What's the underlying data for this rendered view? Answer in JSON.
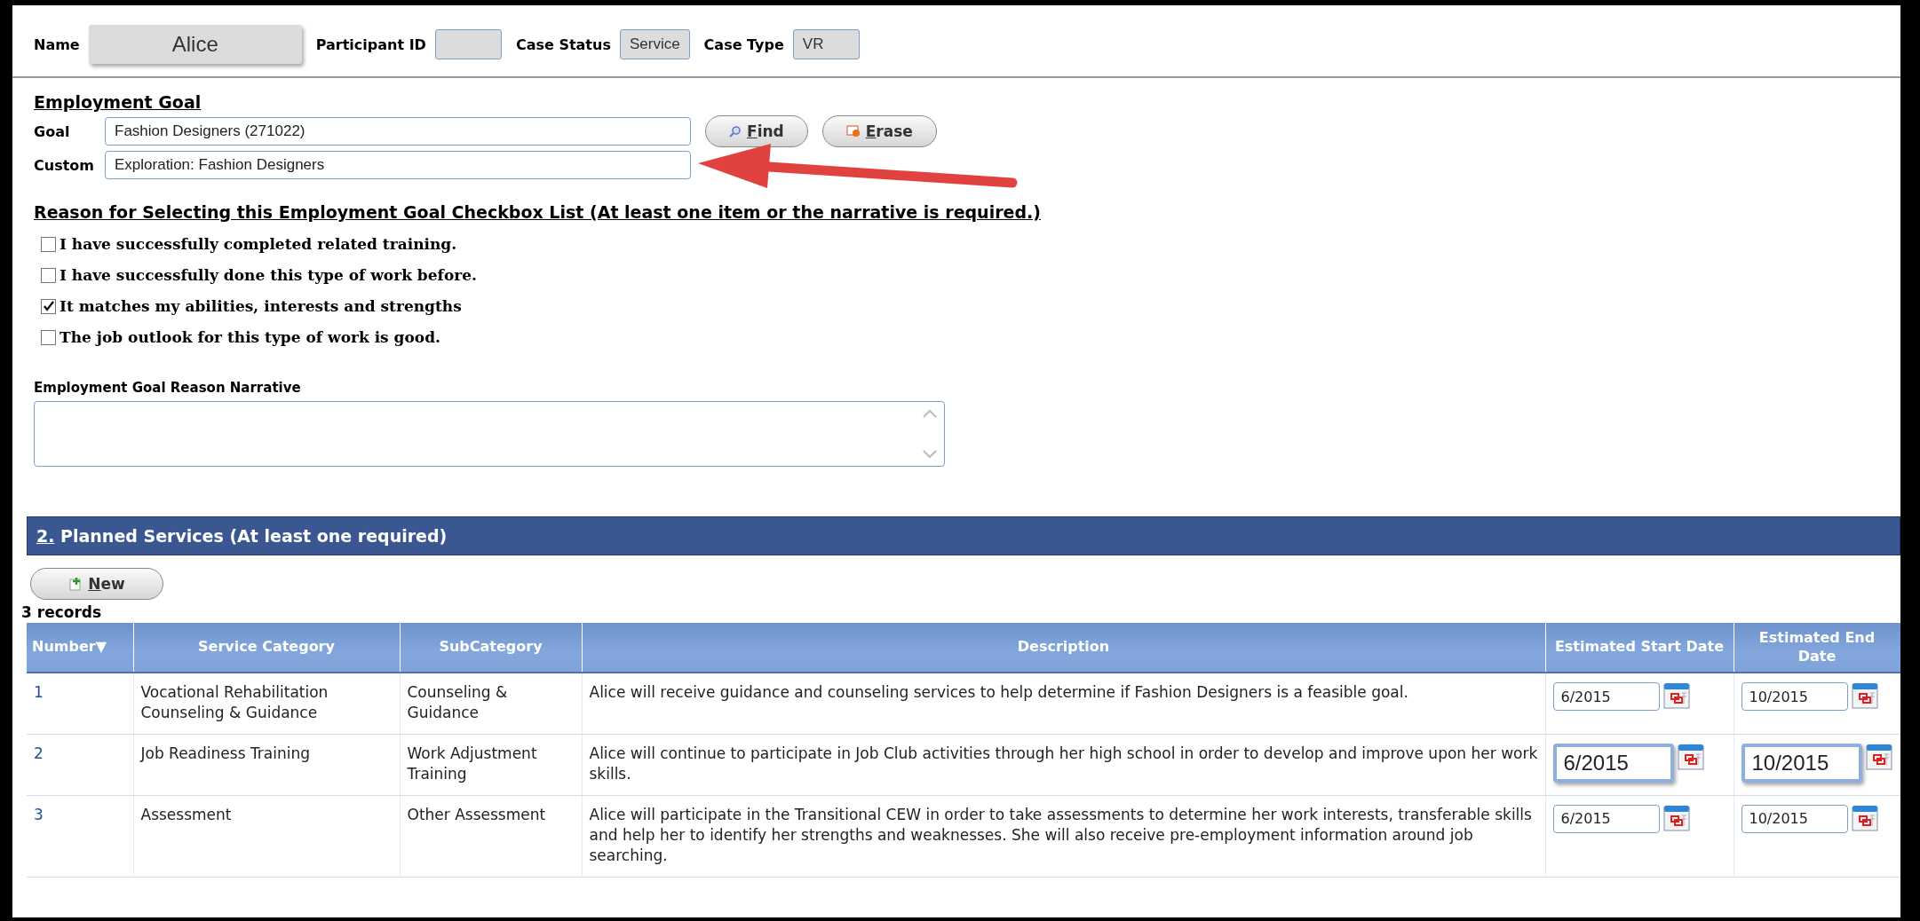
{
  "header": {
    "fields": [
      {
        "label": "Name",
        "value": "Alice",
        "kind": "name"
      },
      {
        "label": "Participant ID",
        "kind": "plain"
      },
      {
        "label": "Case Status",
        "value": "Service",
        "kind": "plain"
      },
      {
        "label": "Case Type",
        "value": "VR",
        "kind": "plain"
      }
    ]
  },
  "employment_goal": {
    "title": "Employment Goal",
    "goal": {
      "label": "Goal",
      "value": "Fashion Designers (271022)"
    },
    "custom": {
      "label": "Custom",
      "value": "Exploration: Fashion Designers"
    },
    "buttons": [
      {
        "label": "Find",
        "kind": "find"
      },
      {
        "label": "Erase",
        "kind": "erase"
      }
    ]
  },
  "reasons": {
    "title": "Reason for Selecting this Employment Goal Checkbox List (At least one item or the narrative is required.)",
    "items": [
      {
        "label": "I have successfully completed related training.",
        "checked": false
      },
      {
        "label": "I have successfully done this type of work before.",
        "checked": false
      },
      {
        "label": "It matches my abilities, interests and strengths",
        "checked": true
      },
      {
        "label": "The job outlook for this type of work is good.",
        "checked": false
      }
    ]
  },
  "narrative": {
    "label": "Employment Goal Reason Narrative"
  },
  "planned_services": {
    "title": "2. Planned Services (At least one required)",
    "new_button": "New",
    "record_count": "3 records",
    "table": {
      "columns": [
        "Number▼",
        "Service Category",
        "SubCategory",
        "Description",
        "Estimated Start Date",
        "Estimated End Date"
      ],
      "rows": [
        {
          "number": "1",
          "category": "Vocational Rehabilitation Counseling & Guidance",
          "subcategory": "Counseling & Guidance",
          "description": "Alice will receive guidance and counseling services to help determine if Fashion Designers is a feasible goal.",
          "start": "6/2015",
          "end": "10/2015",
          "emphasized": false
        },
        {
          "number": "2",
          "category": "Job Readiness Training",
          "subcategory": "Work Adjustment Training",
          "description": "Alice will continue to participate in Job Club activities through her high school in order to develop and improve upon her work skills.",
          "start": "6/2015",
          "end": "10/2015",
          "emphasized": true
        },
        {
          "number": "3",
          "category": "Assessment",
          "subcategory": "Other Assessment",
          "description": "Alice will participate in the Transitional CEW in order to take assessments to determine her work interests, transferable skills and help her to identify her strengths and weaknesses. She will also receive pre-employment information around job searching.",
          "start": "6/2015",
          "end": "10/2015",
          "emphasized": false
        }
      ]
    }
  }
}
